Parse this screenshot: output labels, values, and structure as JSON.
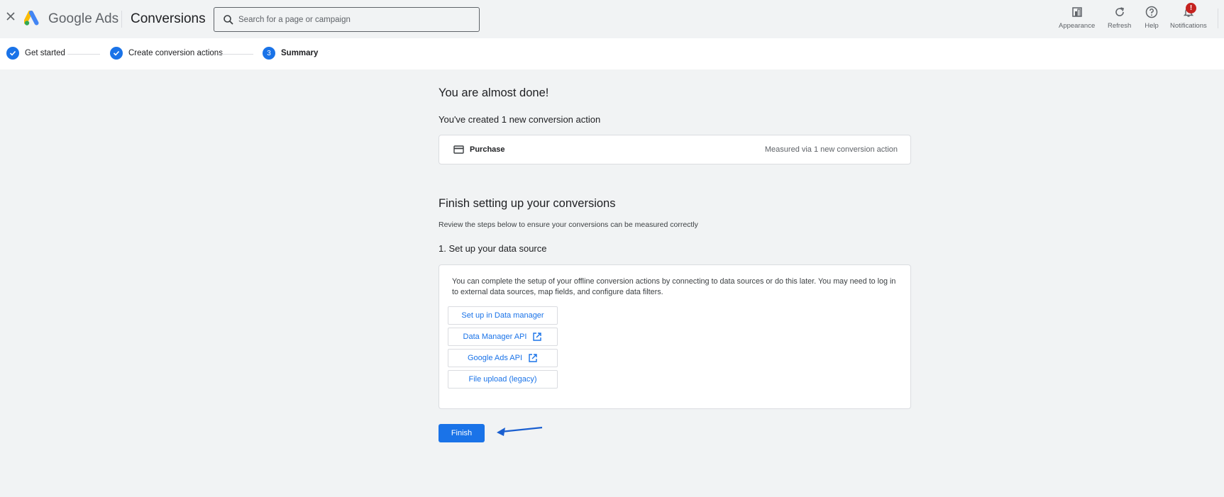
{
  "header": {
    "brand": "Google Ads",
    "page_title": "Conversions",
    "search_placeholder": "Search for a page or campaign",
    "tools": [
      {
        "label": "Appearance",
        "icon": "appearance-icon"
      },
      {
        "label": "Refresh",
        "icon": "refresh-icon"
      },
      {
        "label": "Help",
        "icon": "help-icon"
      },
      {
        "label": "Notifications",
        "icon": "bell-icon",
        "badge": "!"
      }
    ]
  },
  "stepper": {
    "steps": [
      {
        "label": "Get started",
        "state": "done"
      },
      {
        "label": "Create conversion actions",
        "state": "done"
      },
      {
        "label": "Summary",
        "state": "active",
        "number": "3"
      }
    ]
  },
  "summary": {
    "heading": "You are almost done!",
    "created_text": "You've created 1 new conversion action",
    "conversion": {
      "name": "Purchase",
      "icon": "credit-card-icon",
      "measured": "Measured via 1 new conversion action"
    }
  },
  "setup": {
    "heading": "Finish setting up your conversions",
    "subheading": "Review the steps below to ensure your conversions can be measured correctly",
    "step1_title": "1. Set up your data source",
    "step1_description": "You can complete the setup of your offline conversion actions by connecting to data sources or do this later. You may need to log in to external data sources, map fields, and configure data filters.",
    "options": [
      {
        "label": "Set up in Data manager",
        "external": false
      },
      {
        "label": "Data Manager API",
        "external": true
      },
      {
        "label": "Google Ads API",
        "external": true
      },
      {
        "label": "File upload (legacy)",
        "external": false
      }
    ]
  },
  "actions": {
    "finish_label": "Finish"
  },
  "colors": {
    "accent": "#1a73e8",
    "badge": "#c5221f",
    "background": "#f1f3f4"
  }
}
